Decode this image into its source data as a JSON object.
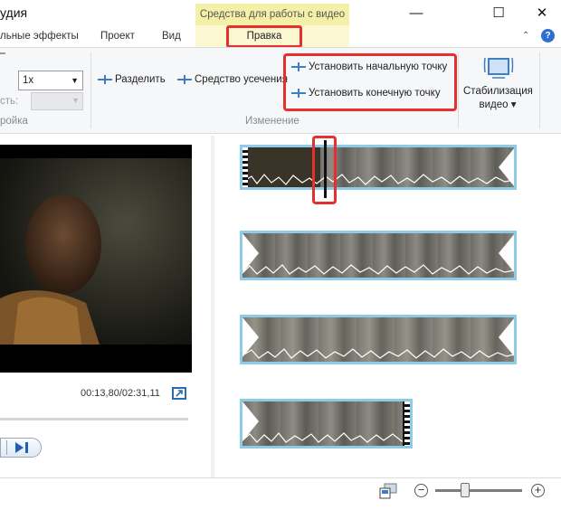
{
  "window": {
    "title": "удия",
    "contextual_band": "Средства для работы с видео",
    "controls": [
      "—",
      "☐",
      "✕"
    ]
  },
  "tabs": {
    "visual_effects": "льные эффекты",
    "project": "Проект",
    "view": "Вид",
    "edit": "Правка"
  },
  "ribbon": {
    "speed_value": "1x",
    "volume_label": "сть:",
    "group_left_label": "ройка",
    "split_label": "Разделить",
    "trim_label": "Средство усечения",
    "set_start_label": "Установить начальную точку",
    "set_end_label": "Установить конечную точку",
    "group_edit_label": "Изменение",
    "stabilization_label": "Стабилизация",
    "stabilization_sub": "видео ▾"
  },
  "preview": {
    "time": "00:13,80/02:31,11"
  },
  "accent": "#2b6cb0",
  "highlight": "#e53030"
}
